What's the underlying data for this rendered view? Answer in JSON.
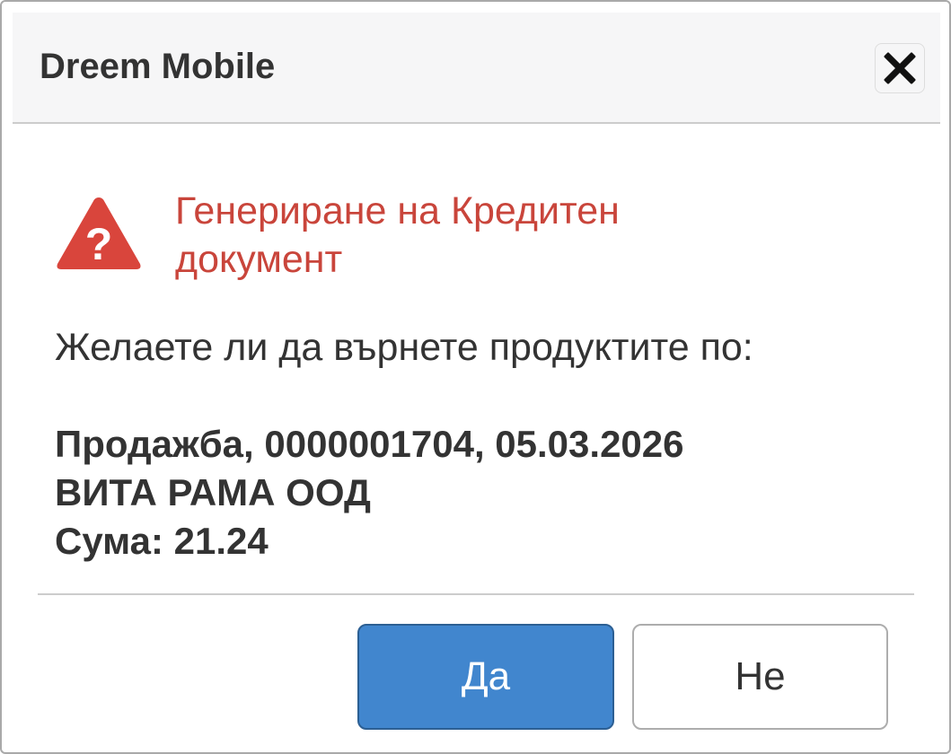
{
  "dialog": {
    "title": "Dreem Mobile",
    "close_icon": "close-icon",
    "warning_icon": "warning-question-icon",
    "heading": "Генериране на Кредитен документ",
    "question": "Желаете ли да върнете продуктите по:",
    "details": {
      "line1": "Продажба, 0000001704, 05.03.2026",
      "line2": "ВИТА РАМА ООД",
      "line3": "Сума: 21.24"
    },
    "buttons": {
      "yes_label": "Да",
      "no_label": "Не"
    }
  },
  "colors": {
    "accent": "#4186ce",
    "heading": "#c9453b",
    "warning_icon": "#d9453c",
    "text": "#333333"
  }
}
